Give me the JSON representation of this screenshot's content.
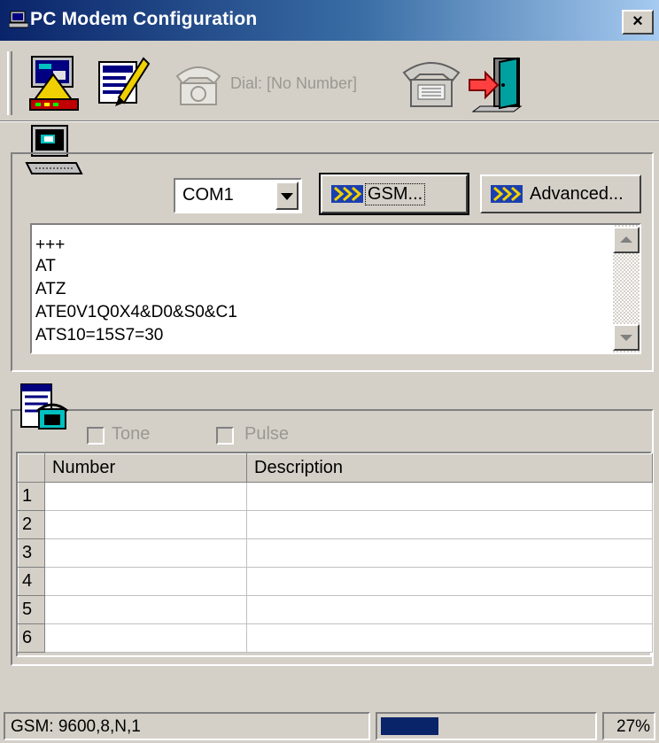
{
  "window": {
    "title": "PC Modem Configuration",
    "close_label": "×"
  },
  "toolbar": {
    "dial_label": "Dial: [No Number]"
  },
  "port": {
    "selected": "COM1"
  },
  "buttons": {
    "gsm_label": "GSM...",
    "advanced_label": "Advanced..."
  },
  "init_commands": [
    "+++",
    "AT",
    "ATZ",
    "ATE0V1Q0X4&D0&S0&C1",
    "ATS10=15S7=30"
  ],
  "dial_mode": {
    "tone_label": "Tone",
    "pulse_label": "Pulse"
  },
  "phonebook": {
    "columns": [
      "Number",
      "Description"
    ],
    "rows": [
      {
        "index": "1",
        "number": "",
        "description": ""
      },
      {
        "index": "2",
        "number": "",
        "description": ""
      },
      {
        "index": "3",
        "number": "",
        "description": ""
      },
      {
        "index": "4",
        "number": "",
        "description": ""
      },
      {
        "index": "5",
        "number": "",
        "description": ""
      },
      {
        "index": "6",
        "number": "",
        "description": ""
      }
    ]
  },
  "status": {
    "connection": "GSM: 9600,8,N,1",
    "progress_fraction": 0.27,
    "progress_text": "27%"
  },
  "colors": {
    "title_bar_start": "#0a246a",
    "face": "#d4d0c8",
    "progress": "#0a246a"
  },
  "icons": {
    "title": "modem-window-icon",
    "toolbar": [
      "modem-monitor-icon",
      "edit-config-icon",
      "dial-phone-icon",
      "telephone-icon",
      "exit-door-icon"
    ],
    "modem_group": "computer-icon",
    "phonebook_group": "phonebook-icon"
  }
}
